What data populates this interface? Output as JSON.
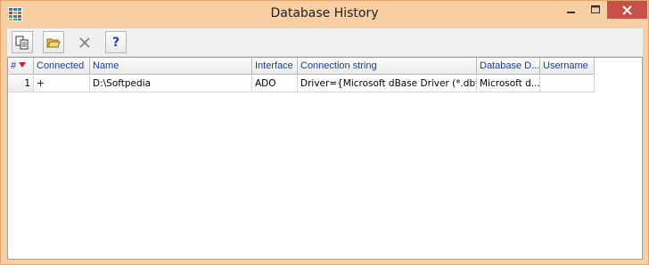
{
  "window": {
    "title": "Database History"
  },
  "toolbar": {
    "help_label": "?"
  },
  "grid": {
    "columns": [
      "#",
      "Connected",
      "Name",
      "Interface",
      "Connection string",
      "Database D...",
      "Username"
    ],
    "rows": [
      {
        "num": "1",
        "connected": "+",
        "name": "D:\\Softpedia",
        "interface": "ADO",
        "connection_string": "Driver={Microsoft dBase Driver (*.dbf...",
        "database_driver": "Microsoft d...",
        "username": ""
      }
    ]
  },
  "colors": {
    "frame": "#f8cfa3",
    "close_button": "#c7504b",
    "header_text": "#1c3ba8",
    "sort_arrow": "#c8212b"
  }
}
